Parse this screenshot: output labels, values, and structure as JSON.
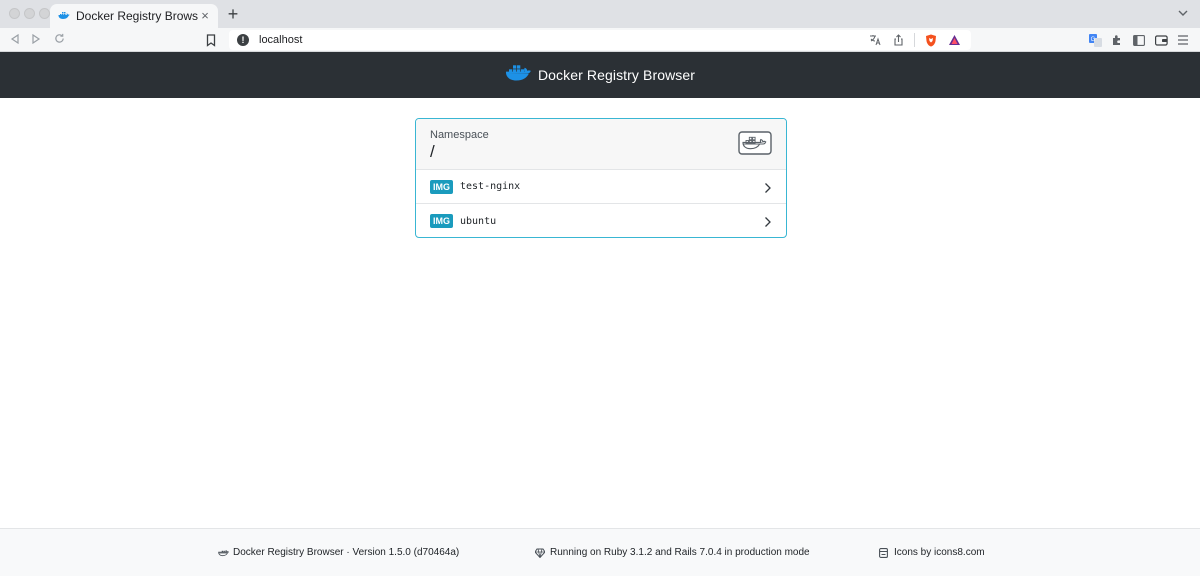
{
  "browser": {
    "tab_title": "Docker Registry Browser",
    "tab_close": "×",
    "new_tab": "+",
    "url": "localhost"
  },
  "header": {
    "title": "Docker Registry Browser"
  },
  "namespace": {
    "label": "Namespace",
    "value": "/"
  },
  "images": [
    {
      "badge": "IMG",
      "name": "test-nginx"
    },
    {
      "badge": "IMG",
      "name": "ubuntu"
    }
  ],
  "footer": {
    "version_text": "Docker Registry Browser · Version 1.5.0 (d70464a)",
    "runtime_text": "Running on Ruby 3.1.2 and Rails 7.0.4 in production mode",
    "icons_text": "Icons by icons8.com"
  },
  "colors": {
    "header_bg": "#2b3035",
    "accent": "#39b6d3",
    "badge": "#1a9bbd",
    "docker_blue": "#1d91e6"
  },
  "icons": [
    "docker-whale-icon",
    "chevron-right-icon",
    "info-icon",
    "translate-icon",
    "share-icon",
    "brave-shield-icon",
    "brave-rewards-icon",
    "extensions-icon",
    "sidebar-icon",
    "wallet-icon",
    "menu-icon"
  ]
}
